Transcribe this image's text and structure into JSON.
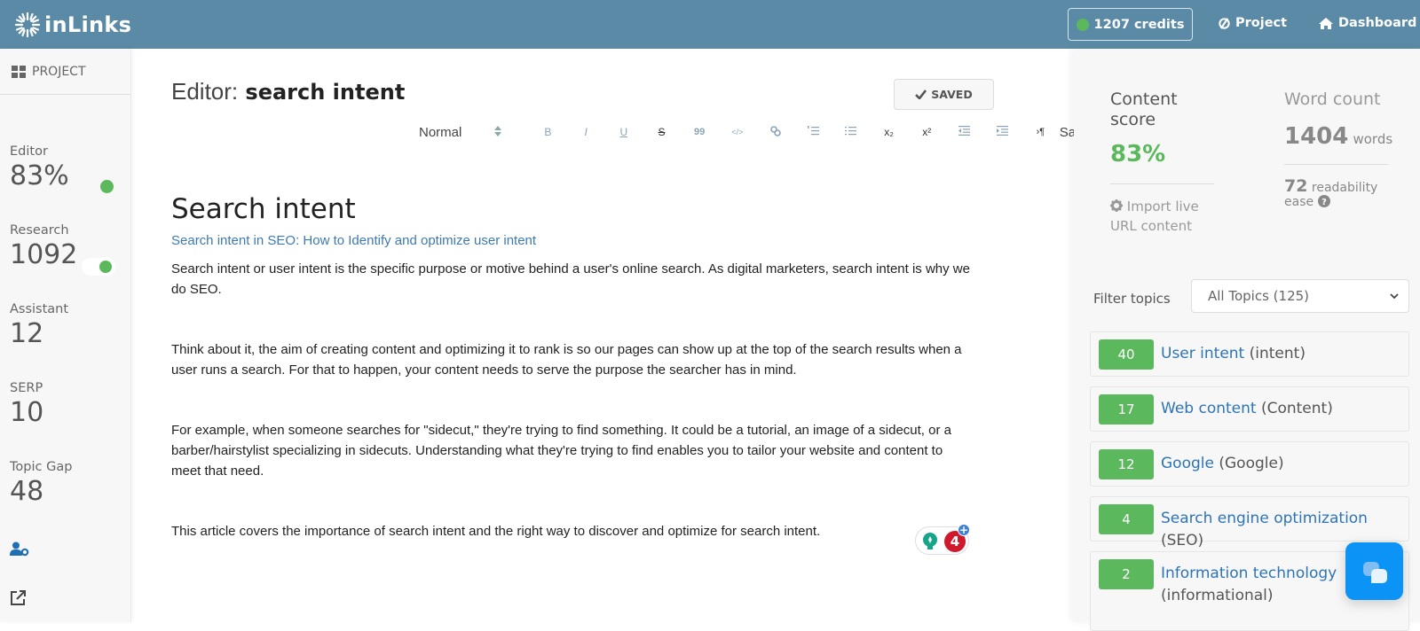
{
  "topbar": {
    "logo_text": "inLinks",
    "credits_label": "1207 credits",
    "project_label": "Project",
    "dashboard_label": "Dashboard",
    "credits_status_color": "#5cb85c"
  },
  "sidebar": {
    "project_label": "PROJECT",
    "stats": [
      {
        "label": "Editor",
        "value": "83%",
        "indicator": "dot"
      },
      {
        "label": "Research",
        "value": "1092",
        "indicator": "toggle"
      },
      {
        "label": "Assistant",
        "value": "12"
      },
      {
        "label": "SERP",
        "value": "10"
      },
      {
        "label": "Topic Gap",
        "value": "48"
      }
    ],
    "icons": [
      "user-settings-icon",
      "external-link-icon"
    ]
  },
  "editor": {
    "title_prefix": "Editor:",
    "title_keyword": "search intent",
    "saved_label": "SAVED",
    "toolbar": {
      "format_select": "Normal",
      "buttons": [
        "bold",
        "italic",
        "underline",
        "strike",
        "blockquote",
        "code",
        "link",
        "ordered-list",
        "bullet-list",
        "subscript",
        "superscript",
        "outdent",
        "indent",
        "text-direction"
      ],
      "bold_glyph": "B",
      "italic_glyph": "I",
      "underline_glyph": "U",
      "strike_glyph": "S",
      "quote_glyph": "99",
      "code_glyph": "</>",
      "sub_glyph": "x₂",
      "sup_glyph": "x²",
      "para_glyph": "›¶",
      "truncated_label": "Sa"
    },
    "document": {
      "heading": "Search intent",
      "subtitle": "Search intent in SEO: How to Identify and optimize user intent",
      "paragraphs": [
        "Search intent or user intent is the specific purpose or motive behind a user's online search. As digital marketers, search intent is why we do SEO.",
        "Think about it, the aim of creating content and optimizing it to rank is so our pages can show up at the top of the search results when a user runs a search. For that to happen, your content needs to serve the purpose the searcher has in mind.",
        "For example, when someone searches for \"sidecut,\" they're trying to find something. It could be a tutorial, an image of a sidecut, or a barber/hairstylist specializing in sidecuts. Understanding what they're trying to find enables you to tailor your website and content to meet that need.",
        "This article covers the importance of search intent and the right way to discover and optimize for search intent."
      ]
    },
    "assistant_badge": {
      "count": "4",
      "plus": "+"
    }
  },
  "right_panel": {
    "content_score_label": "Content score",
    "content_score_value": "83%",
    "import_label": "Import live URL content",
    "word_count_label": "Word count",
    "word_count_value": "1404",
    "word_count_unit": "words",
    "readability_value": "72",
    "readability_label": "readability ease",
    "filter_label": "Filter topics",
    "filter_selected": "All Topics (125)",
    "topics": [
      {
        "count": "40",
        "name": "User intent",
        "type": "(intent)"
      },
      {
        "count": "17",
        "name": "Web content",
        "type": "(Content)"
      },
      {
        "count": "12",
        "name": "Google",
        "type": "(Google)"
      },
      {
        "count": "4",
        "name": "Search engine optimization",
        "type": "(SEO)"
      },
      {
        "count": "2",
        "name": "Information technology",
        "type": "(informational)"
      }
    ],
    "accent_color": "#5cb85c",
    "link_color": "#2d74b5"
  }
}
